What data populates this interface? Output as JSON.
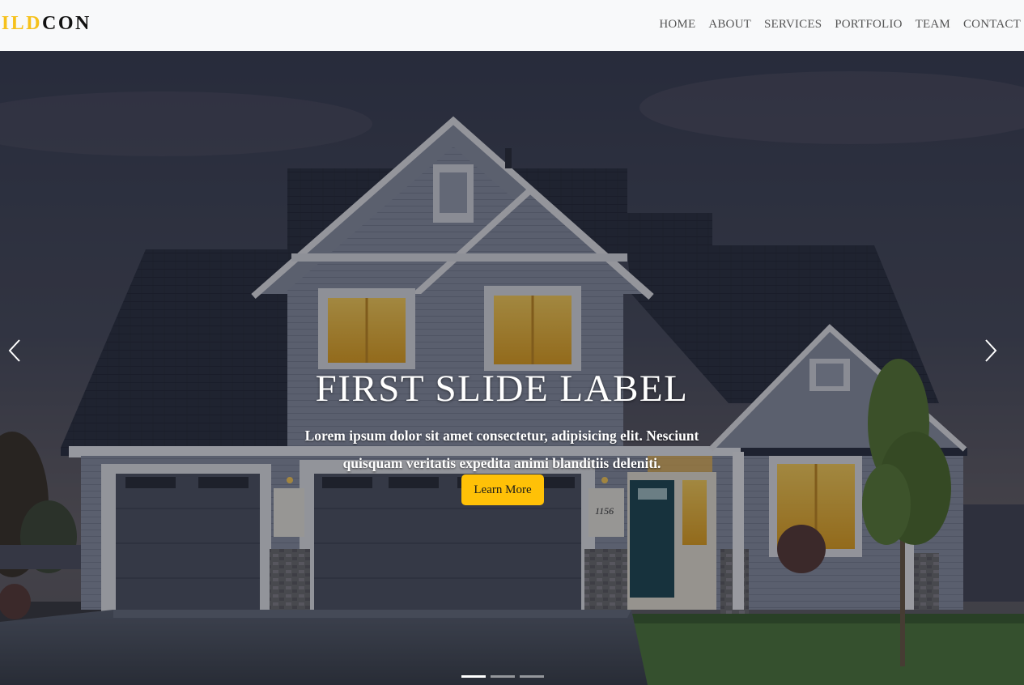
{
  "brand": {
    "part1": "UILD",
    "part2": "CON"
  },
  "nav": {
    "items": [
      {
        "label": "HOME"
      },
      {
        "label": "ABOUT"
      },
      {
        "label": "SERVICES"
      },
      {
        "label": "PORTFOLIO"
      },
      {
        "label": "TEAM"
      },
      {
        "label": "CONTACT"
      }
    ]
  },
  "hero": {
    "title": "FIRST SLIDE LABEL",
    "text": "Lorem ipsum dolor sit amet consectetur, adipisicing elit. Nesciunt quisquam veritatis expedita animi blanditiis deleniti.",
    "button_label": "Learn More",
    "house_number": "1156",
    "slide_count": 3,
    "active_slide": 1,
    "icons": {
      "prev": "chevron-left-icon",
      "next": "chevron-right-icon"
    }
  },
  "colors": {
    "accent": "#ffc107",
    "brand_yellow": "#f6c11b",
    "navbar_bg": "#f8f9fa",
    "nav_text": "#555555"
  }
}
